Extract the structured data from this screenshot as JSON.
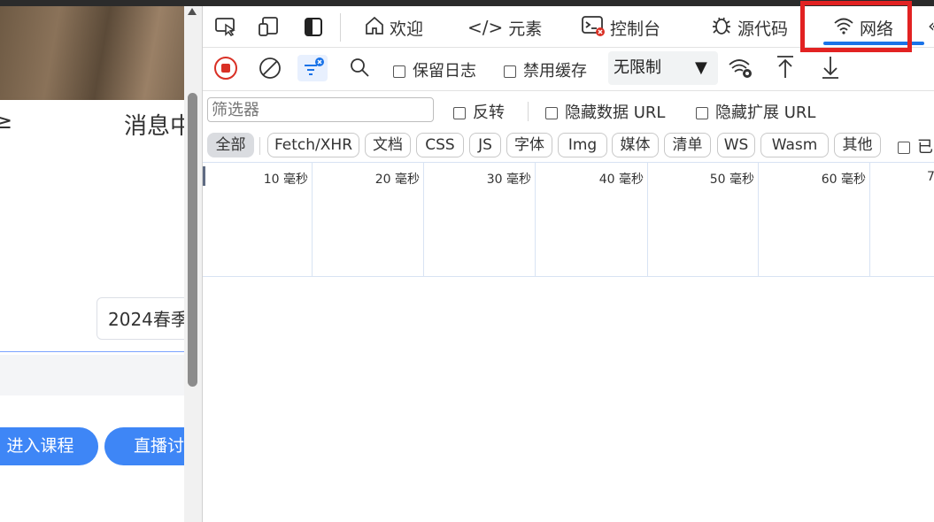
{
  "page": {
    "nav_partial_left": "≥",
    "nav_message": "消息中",
    "term_select_value": "2024春季",
    "enter_course_button": "进入课程",
    "live_button": "直播讨"
  },
  "devtools": {
    "tabs": [
      {
        "label": "欢迎",
        "icon": "home-icon"
      },
      {
        "label": "元素",
        "icon": "code-icon"
      },
      {
        "label": "控制台",
        "icon": "console-icon"
      },
      {
        "label": "源代码",
        "icon": "bug-icon"
      },
      {
        "label": "网络",
        "icon": "wifi-icon",
        "active": true
      }
    ],
    "toolbar": {
      "preserve_log": "保留日志",
      "disable_cache": "禁用缓存",
      "throttling": "无限制"
    },
    "filter": {
      "placeholder": "筛选器",
      "invert": "反转",
      "hide_data_urls": "隐藏数据 URL",
      "hide_extension_urls": "隐藏扩展 URL"
    },
    "types": [
      "全部",
      "Fetch/XHR",
      "文档",
      "CSS",
      "JS",
      "字体",
      "Img",
      "媒体",
      "清单",
      "WS",
      "Wasm",
      "其他"
    ],
    "types_trailing": "已",
    "timeline": [
      "10 毫秒",
      "20 毫秒",
      "30 毫秒",
      "40 毫秒",
      "50 毫秒",
      "60 毫秒",
      "7"
    ]
  },
  "colors": {
    "accent_blue": "#1a73e8",
    "highlight_red": "#e22222",
    "button_blue": "#3e86f6",
    "record_red": "#d93025"
  }
}
